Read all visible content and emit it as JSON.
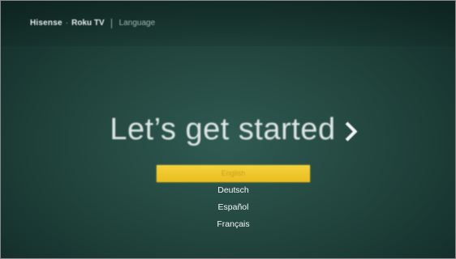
{
  "header": {
    "brand_maker": "Hisense",
    "brand_separator": "·",
    "brand_product": "Roku TV",
    "screen_name": "Language"
  },
  "main": {
    "headline": "Let’s get started",
    "next_icon": "chevron-right-icon"
  },
  "languages": {
    "items": [
      {
        "label": "English",
        "selected": true
      },
      {
        "label": "Deutsch",
        "selected": false
      },
      {
        "label": "Español",
        "selected": false
      },
      {
        "label": "Français",
        "selected": false
      }
    ]
  },
  "colors": {
    "background": "#23473f",
    "highlight": "#eec62a",
    "text": "#f4f6f5"
  }
}
